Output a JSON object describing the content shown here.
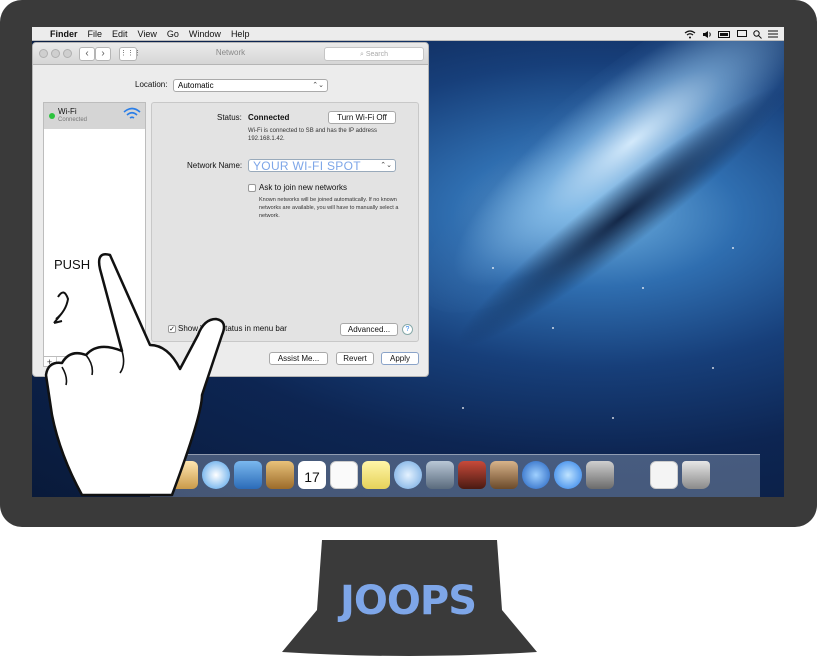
{
  "menubar": {
    "apple_glyph": "",
    "items": [
      "Finder",
      "File",
      "Edit",
      "View",
      "Go",
      "Window",
      "Help"
    ]
  },
  "window": {
    "title": "Network",
    "search_placeholder": "Search",
    "location_label": "Location:",
    "location_value": "Automatic",
    "sidebar": {
      "items": [
        {
          "name": "Wi-Fi",
          "status": "Connected"
        }
      ]
    },
    "status_label": "Status:",
    "status_value": "Connected",
    "turn_off_button": "Turn Wi-Fi Off",
    "status_detail": "Wi-Fi is connected to SB and has the IP address 192.168.1.42.",
    "network_name_label": "Network Name:",
    "network_name_value": "YOUR WI-FI SPOT",
    "ask_join_label": "Ask to join new networks",
    "ask_join_detail": "Known networks will be joined automatically. If no known networks are available, you will have to manually select a network.",
    "show_status_label": "Show Wi-Fi status in menu bar",
    "advanced_button": "Advanced...",
    "help_glyph": "?",
    "assist_button": "Assist Me...",
    "revert_button": "Revert",
    "apply_button": "Apply"
  },
  "overlay": {
    "push_label": "PUSH"
  },
  "dock": {
    "calendar_day": "17"
  },
  "brand": {
    "logo_text": "JOOPS"
  },
  "colors": {
    "accent": "#2a7ee8",
    "connected": "#2cc33e",
    "network_name": "#7ea6e8",
    "logo": "#7ea6e8"
  }
}
